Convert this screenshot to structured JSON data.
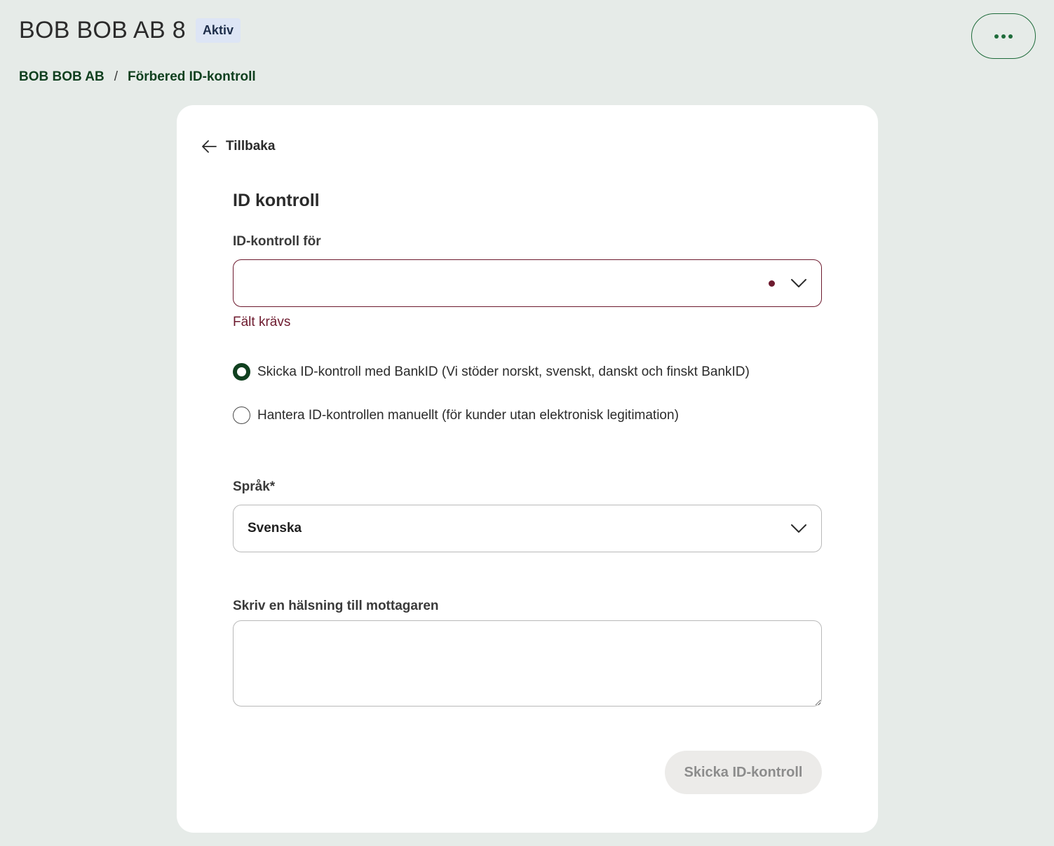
{
  "header": {
    "title": "BOB BOB AB 8",
    "status": "Aktiv",
    "more_icon": "more-horizontal-icon"
  },
  "breadcrumb": {
    "items": [
      "BOB BOB AB",
      "Förbered ID-kontroll"
    ],
    "separator": "/"
  },
  "card": {
    "back_label": "Tillbaka",
    "section_title": "ID kontroll",
    "id_for": {
      "label": "ID-kontroll för",
      "value": "",
      "error": "Fält krävs"
    },
    "method": {
      "options": [
        {
          "label": "Skicka ID-kontroll med BankID (Vi stöder norskt, svenskt, danskt och finskt BankID)",
          "checked": true
        },
        {
          "label": "Hantera ID-kontrollen manuellt (för kunder utan elektronisk legitimation)",
          "checked": false
        }
      ]
    },
    "language": {
      "label": "Språk*",
      "value": "Svenska"
    },
    "greeting": {
      "label": "Skriv en hälsning till mottagaren",
      "value": ""
    },
    "submit_label": "Skicka ID-kontroll"
  },
  "colors": {
    "page_bg": "#e6ebe8",
    "brand_green": "#10401f",
    "error": "#6d1a2e",
    "badge_bg": "#dde5f5"
  }
}
